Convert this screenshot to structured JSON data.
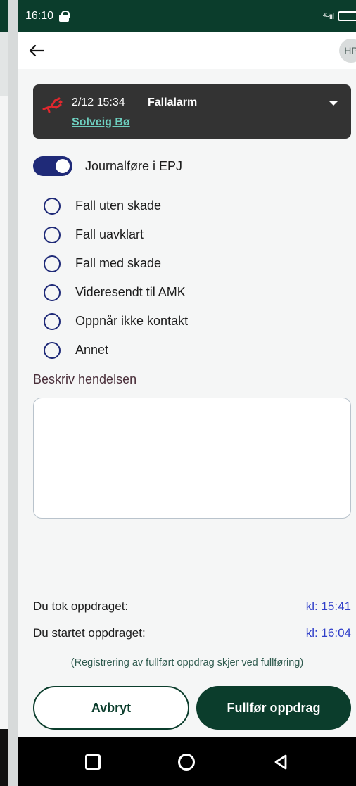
{
  "statusbar": {
    "time": "16:10",
    "signal": "⁴ᴳııl"
  },
  "appbar": {
    "avatar_initials": "HP"
  },
  "alarm": {
    "time": "2/12 15:34",
    "type": "Fallalarm",
    "person": "Solveig Bø",
    "icon_color": "#e0282e"
  },
  "journal": {
    "label": "Journalføre i EPJ",
    "enabled": true
  },
  "options": [
    {
      "label": "Fall uten skade"
    },
    {
      "label": "Fall uavklart"
    },
    {
      "label": "Fall med skade"
    },
    {
      "label": "Videresendt til AMK"
    },
    {
      "label": "Oppnår ikke kontakt"
    },
    {
      "label": "Annet"
    }
  ],
  "describe": {
    "label": "Beskriv hendelsen",
    "value": ""
  },
  "assignment": {
    "took_label": "Du tok oppdraget:",
    "took_time": "kl: 15:41",
    "started_label": "Du startet oppdraget:",
    "started_time": "kl: 16:04",
    "note": "(Registrering av fullført oppdrag skjer ved fullføring)"
  },
  "buttons": {
    "cancel": "Avbryt",
    "finish": "Fullfør oppdrag"
  },
  "colors": {
    "brand_dark": "#0b3d2c",
    "accent": "#1f2a78",
    "link": "#2f3ec9"
  }
}
